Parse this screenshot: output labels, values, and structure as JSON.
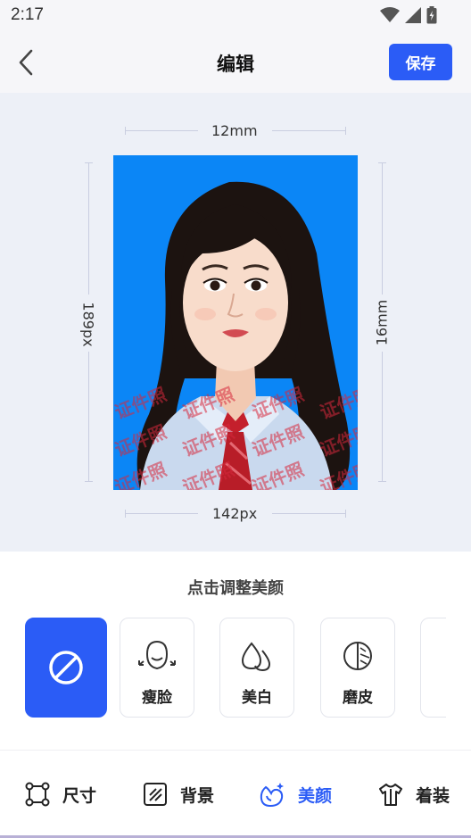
{
  "status_bar": {
    "time": "2:17"
  },
  "header": {
    "title": "编辑",
    "save_label": "保存"
  },
  "photo": {
    "width_mm": "12mm",
    "height_mm": "16mm",
    "width_px": "142px",
    "height_px": "189px",
    "watermark": "证件照",
    "background_color": "#0b86f6"
  },
  "beauty": {
    "hint": "点击调整美颜",
    "options": [
      {
        "label": "",
        "icon": "ban-icon",
        "selected": true
      },
      {
        "label": "瘦脸",
        "icon": "face-slim-icon"
      },
      {
        "label": "美白",
        "icon": "whiten-drops-icon"
      },
      {
        "label": "磨皮",
        "icon": "smooth-skin-icon"
      },
      {
        "label": "",
        "icon": "partial-icon"
      }
    ]
  },
  "bottom_nav": {
    "items": [
      {
        "label": "尺寸",
        "icon": "crop-size-icon"
      },
      {
        "label": "背景",
        "icon": "background-icon"
      },
      {
        "label": "美颜",
        "icon": "beauty-icon",
        "active": true
      },
      {
        "label": "着装",
        "icon": "clothing-icon"
      }
    ]
  },
  "colors": {
    "accent": "#2b5cf6",
    "preview_bg": "#edf0f7"
  }
}
